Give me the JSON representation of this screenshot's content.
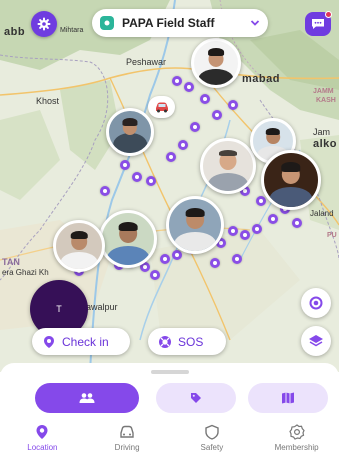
{
  "header": {
    "circle_name": "PAPA Field Staff",
    "icons": {
      "settings": "gear-icon",
      "circle": "circle-group-icon",
      "dropdown": "chevron-down-icon",
      "chat": "chat-icon"
    },
    "has_notification": true
  },
  "map": {
    "city_labels": [
      {
        "id": "abb",
        "text": "abb"
      },
      {
        "id": "mihtara",
        "text": "Mihtara"
      },
      {
        "id": "peshawar",
        "text": "Peshawar"
      },
      {
        "id": "khost",
        "text": "Khost"
      },
      {
        "id": "islamabad",
        "text": "mabad"
      },
      {
        "id": "jamm",
        "text": "JAMM"
      },
      {
        "id": "kash",
        "text": "KASH"
      },
      {
        "id": "jam",
        "text": "Jam"
      },
      {
        "id": "sialkot",
        "text": "alko"
      },
      {
        "id": "jaland",
        "text": "Jaland"
      },
      {
        "id": "tan",
        "text": "TAN"
      },
      {
        "id": "dgk",
        "text": "era Ghazi Kh"
      },
      {
        "id": "bahawalpur",
        "text": "awalpur"
      },
      {
        "id": "pu",
        "text": "PU"
      }
    ],
    "members": [
      {
        "id": "m1",
        "label": "Member 1"
      },
      {
        "id": "m2",
        "label": "Member 2"
      },
      {
        "id": "m3",
        "label": "Member 3"
      },
      {
        "id": "m4",
        "label": "Member 4"
      },
      {
        "id": "m5",
        "label": "Member 5"
      },
      {
        "id": "m6",
        "label": "Member 6"
      },
      {
        "id": "m7",
        "label": "Member 7"
      },
      {
        "id": "m8",
        "label": "Member 8"
      },
      {
        "id": "m9",
        "label": "Member 9"
      }
    ],
    "initial_avatar": "T"
  },
  "actions": {
    "checkin_label": "Check in",
    "sos_label": "SOS"
  },
  "tabs_segment": {
    "items": [
      "people-icon",
      "tag-icon",
      "map-places-icon"
    ],
    "active": 0
  },
  "bottom_nav": {
    "items": [
      {
        "label": "Location",
        "icon": "location-pin-icon"
      },
      {
        "label": "Driving",
        "icon": "car-icon"
      },
      {
        "label": "Safety",
        "icon": "shield-icon"
      },
      {
        "label": "Membership",
        "icon": "membership-badge-icon"
      }
    ],
    "active": 0
  },
  "colors": {
    "accent": "#8549ea",
    "dark_purple": "#361057",
    "map_bg": "#e9eddf",
    "circle_icon": "#2bb59a",
    "notification": "#e0345a"
  }
}
